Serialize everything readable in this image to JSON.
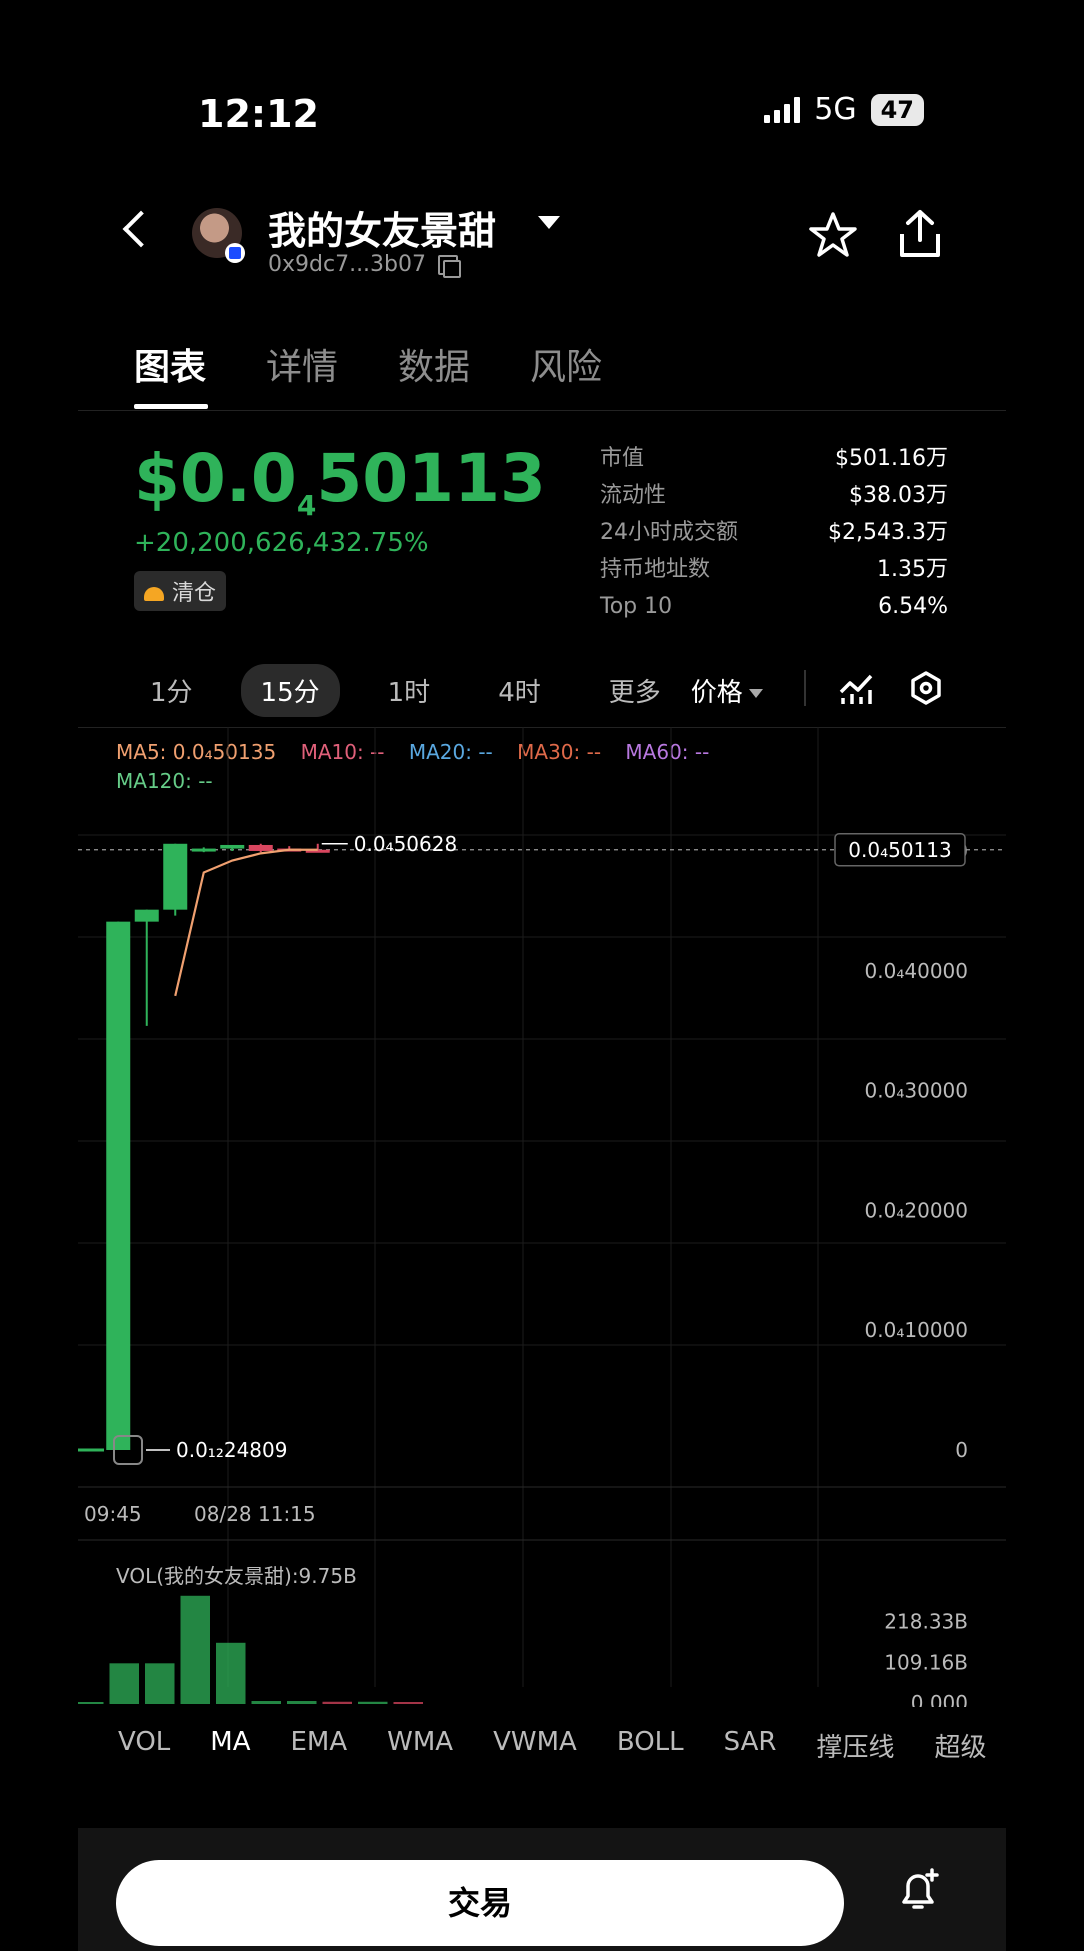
{
  "status_bar": {
    "time": "12:12",
    "network": "5G",
    "battery": "47"
  },
  "header": {
    "token_name": "我的女友景甜",
    "address": "0x9dc7...3b07"
  },
  "tabs": [
    "图表",
    "详情",
    "数据",
    "风险"
  ],
  "price": {
    "prefix": "$0.0",
    "zeros": "4",
    "digits": "50113",
    "change": "+20,200,626,432.75%",
    "tag": "清仓"
  },
  "stats": [
    {
      "label": "市值",
      "value": "$501.16万"
    },
    {
      "label": "流动性",
      "value": "$38.03万"
    },
    {
      "label": "24小时成交额",
      "value": "$2,543.3万"
    },
    {
      "label": "持币地址数",
      "value": "1.35万"
    },
    {
      "label": "Top 10",
      "value": "6.54%"
    }
  ],
  "timeframes": [
    "1分",
    "15分",
    "1时",
    "4时",
    "更多"
  ],
  "price_dropdown": "价格",
  "ma_legend": {
    "ma5": "MA5: 0.0₄50135",
    "ma10": "MA10: --",
    "ma20": "MA20: --",
    "ma30": "MA30: --",
    "ma60": "MA60: --",
    "ma120": "MA120: --"
  },
  "colors": {
    "up": "#2fb35a",
    "down": "#d9465f",
    "ma5": "#f0a070",
    "ma10": "#e0607a",
    "ma20": "#5aa8e0",
    "ma30": "#e06a4a",
    "ma60": "#b878e0",
    "ma120": "#66cc88"
  },
  "chart_data": {
    "type": "candlestick",
    "y_unit_note": "0.0₄ means 0.0000",
    "ylim": [
      0,
      5.2e-05
    ],
    "y_ticks": [
      "0.0₄50000",
      "0.0₄40000",
      "0.0₄30000",
      "0.0₄20000",
      "0.0₄10000",
      "0"
    ],
    "y_tick_values": [
      5e-05,
      4e-05,
      3e-05,
      2e-05,
      1e-05,
      0
    ],
    "x_ticks": [
      "09:45",
      "08/28 11:15"
    ],
    "current_price_label": "0.0₄50113",
    "current_price": 5.01e-05,
    "high_label": "0.0₄50628",
    "high": 5.06e-05,
    "low_label": "0.0₁₂24809",
    "low": 0.0,
    "candles": [
      {
        "o": 0.0,
        "h": 4.41e-05,
        "l": 0.0,
        "c": 4.41e-05
      },
      {
        "o": 4.41e-05,
        "h": 4.51e-05,
        "l": 3.54e-05,
        "c": 4.51e-05
      },
      {
        "o": 4.51e-05,
        "h": 5.06e-05,
        "l": 4.46e-05,
        "c": 5.06e-05
      },
      {
        "o": 5.01e-05,
        "h": 5.03e-05,
        "l": 4.99e-05,
        "c": 5.02e-05
      },
      {
        "o": 5.02e-05,
        "h": 5.04e-05,
        "l": 5e-05,
        "c": 5.05e-05
      },
      {
        "o": 5.05e-05,
        "h": 5.06e-05,
        "l": 4.99e-05,
        "c": 5e-05
      },
      {
        "o": 5.02e-05,
        "h": 5.04e-05,
        "l": 5e-05,
        "c": 5e-05
      },
      {
        "o": 5.01e-05,
        "h": 5.06e-05,
        "l": 4.99e-05,
        "c": 5e-05
      }
    ],
    "ma5": [
      null,
      null,
      3.79e-05,
      4.82e-05,
      4.92e-05,
      4.98e-05,
      5.01e-05,
      5.01e-05
    ],
    "volume_label": "VOL(我的女友景甜):9.75B",
    "volume_ticks": [
      "218.33B",
      "109.16B",
      "0.000"
    ],
    "volume_tick_values": [
      218.33,
      109.16,
      0
    ],
    "volumes": [
      0,
      109,
      109,
      290,
      164,
      8,
      8,
      6,
      6,
      5
    ],
    "volume_colors": [
      "up",
      "up",
      "up",
      "up",
      "up",
      "up",
      "up",
      "down",
      "up",
      "down"
    ]
  },
  "indicator_tabs": [
    "VOL",
    "MA",
    "EMA",
    "WMA",
    "VWMA",
    "BOLL",
    "SAR",
    "撑压线",
    "超级"
  ],
  "trade_button": "交易"
}
